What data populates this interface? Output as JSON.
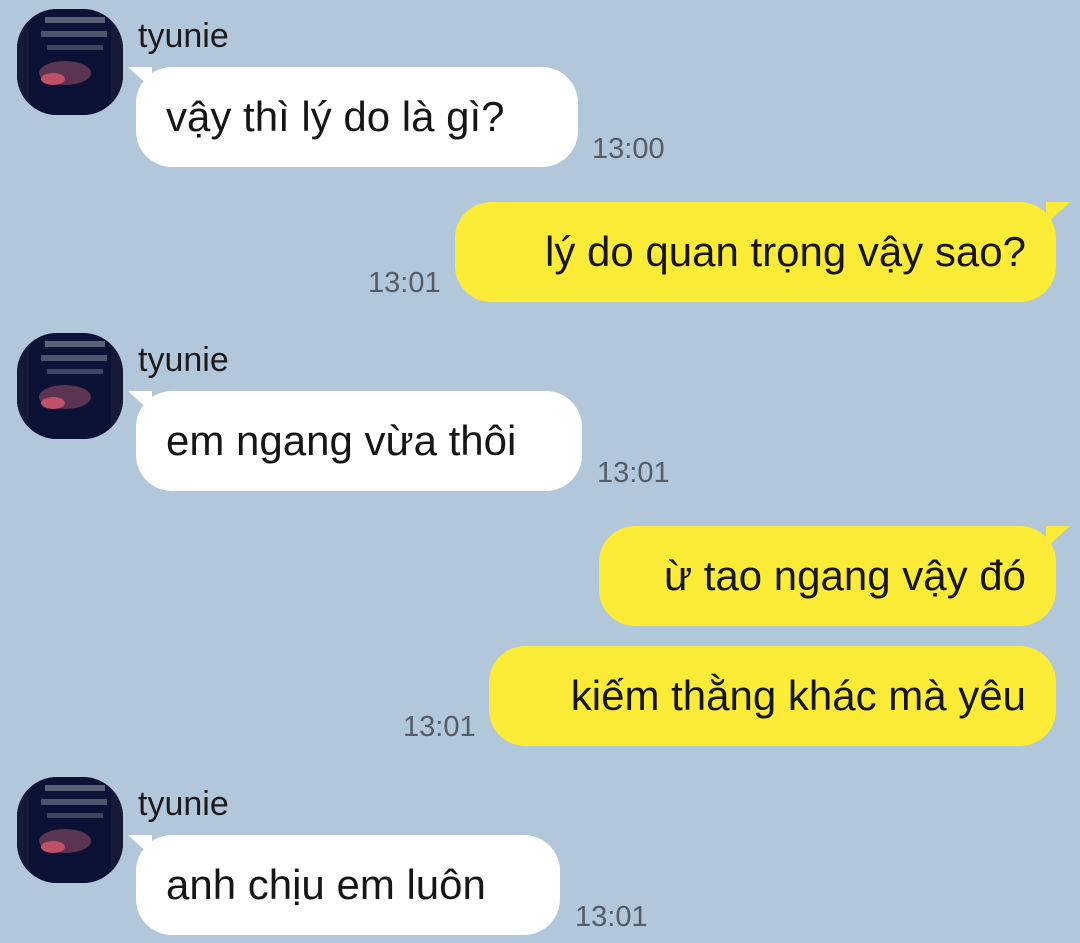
{
  "contact": {
    "name": "tyunie"
  },
  "colors": {
    "background": "#b2c7da",
    "incoming_bubble": "#ffffff",
    "outgoing_bubble": "#fceb37"
  },
  "messages": [
    {
      "direction": "in",
      "sender": "tyunie",
      "text": "vậy thì lý do là gì?",
      "time": "13:00"
    },
    {
      "direction": "out",
      "text": "lý do quan trọng vậy sao?",
      "time": "13:01"
    },
    {
      "direction": "in",
      "sender": "tyunie",
      "text": "em ngang vừa thôi",
      "time": "13:01"
    },
    {
      "direction": "out",
      "text": "ừ tao ngang vậy đó",
      "time": ""
    },
    {
      "direction": "out",
      "text": "kiếm thằng khác mà yêu",
      "time": "13:01"
    },
    {
      "direction": "in",
      "sender": "tyunie",
      "text": "anh chịu em luôn",
      "time": "13:01"
    }
  ]
}
